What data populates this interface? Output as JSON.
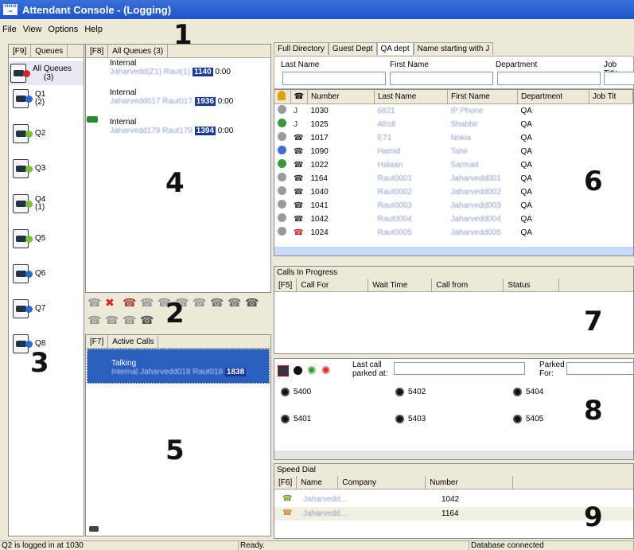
{
  "window": {
    "title": "Attendant Console - (Logging)"
  },
  "menu": [
    "File",
    "View",
    "Options",
    "Help"
  ],
  "annotations": [
    "1",
    "2",
    "3",
    "4",
    "5",
    "6",
    "7",
    "8",
    "9"
  ],
  "queues": {
    "key": "[F9]",
    "header": "Queues",
    "items": [
      {
        "label": "All Queues",
        "count": "(3)"
      },
      {
        "label": "Q1",
        "count": "(2)"
      },
      {
        "label": "Q2",
        "count": ""
      },
      {
        "label": "Q3",
        "count": ""
      },
      {
        "label": "Q4",
        "count": "(1)"
      },
      {
        "label": "Q5",
        "count": ""
      },
      {
        "label": "Q6",
        "count": ""
      },
      {
        "label": "Q7",
        "count": ""
      },
      {
        "label": "Q8",
        "count": ""
      }
    ]
  },
  "queue_calls": {
    "key": "[F8]",
    "header": "All Queues (3)",
    "calls": [
      {
        "type": "Internal",
        "name": "Jaharvedd(Z1) Raut(1)",
        "ext": "1140",
        "time": "0:00"
      },
      {
        "type": "Internal",
        "name": "Jaharvedd017 Raut017",
        "ext": "1936",
        "time": "0:00"
      },
      {
        "type": "Internal",
        "name": "Jaharvedd179 Raut179",
        "ext": "1394",
        "time": "0:00"
      }
    ]
  },
  "active_calls": {
    "key": "[F7]",
    "header": "Active Calls",
    "items": [
      {
        "state": "Talking",
        "detail": "Internal Jaharvedd018 Raut018",
        "ext": "1838"
      }
    ]
  },
  "directory": {
    "tabs": [
      "Full Directory",
      "Guest Dept",
      "QA dept",
      "Name starting with J"
    ],
    "active_tab": "QA dept",
    "filters": [
      "Last Name",
      "First Name",
      "Department",
      "Job Title"
    ],
    "columns": [
      "Number",
      "Last Name",
      "First Name",
      "Department",
      "Job Tit"
    ],
    "rows": [
      {
        "status": "#9a9a9a",
        "dev": "handset",
        "number": "1030",
        "last": "6821",
        "first": "IP Phone",
        "dept": "QA"
      },
      {
        "status": "#3a9a3a",
        "dev": "handset",
        "number": "1025",
        "last": "Afridi",
        "first": "Shabbir",
        "dept": "QA"
      },
      {
        "status": "#9a9a9a",
        "dev": "phone",
        "number": "1017",
        "last": "E71",
        "first": "Nokia",
        "dept": "QA"
      },
      {
        "status": "#3b6fd0",
        "dev": "phone",
        "number": "1090",
        "last": "Hamid",
        "first": "Tahir",
        "dept": "QA"
      },
      {
        "status": "#3a9a3a",
        "dev": "phone",
        "number": "1022",
        "last": "Halaan",
        "first": "Sarmad",
        "dept": "QA"
      },
      {
        "status": "#9a9a9a",
        "dev": "phone",
        "number": "1164",
        "last": "Raut0001",
        "first": "Jaharvedd001",
        "dept": "QA"
      },
      {
        "status": "#9a9a9a",
        "dev": "phone",
        "number": "1040",
        "last": "Raut0002",
        "first": "Jaharvedd002",
        "dept": "QA"
      },
      {
        "status": "#9a9a9a",
        "dev": "phone",
        "number": "1041",
        "last": "Raut0003",
        "first": "Jaharvedd003",
        "dept": "QA"
      },
      {
        "status": "#9a9a9a",
        "dev": "phone",
        "number": "1042",
        "last": "Raut0004",
        "first": "Jaharvedd004",
        "dept": "QA"
      },
      {
        "status": "#9a9a9a",
        "dev": "phone-red",
        "number": "1024",
        "last": "Raut0005",
        "first": "Jaharvedd005",
        "dept": "QA"
      }
    ]
  },
  "calls_in_progress": {
    "title": "Calls In Progress",
    "key": "[F5]",
    "columns": [
      "Call For",
      "Wait Time",
      "Call from",
      "Status"
    ]
  },
  "park": {
    "last_call_label": "Last call parked at:",
    "parked_for_label": "Parked For:",
    "slots": [
      "5400",
      "5402",
      "5404",
      "5401",
      "5403",
      "5405"
    ]
  },
  "speed_dial": {
    "title": "Speed Dial",
    "key": "[F6]",
    "columns": [
      "Name",
      "Company",
      "Number"
    ],
    "rows": [
      {
        "name": "Jaharvedd...",
        "number": "1042"
      },
      {
        "name": "Jaharvedd...",
        "number": "1164"
      }
    ]
  },
  "status": {
    "left": "Q2 is logged in at 1030",
    "middle": "Ready.",
    "right": "Database connected"
  }
}
